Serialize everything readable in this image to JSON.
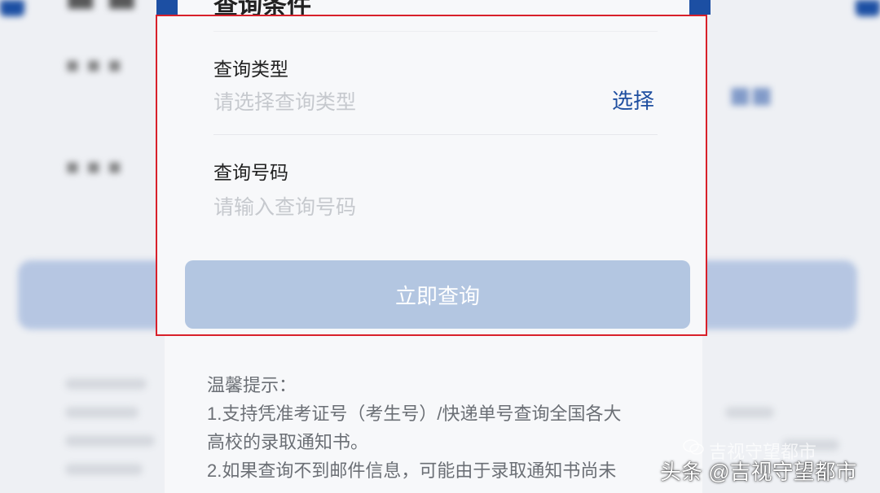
{
  "form": {
    "title": "查询条件",
    "type_label": "查询类型",
    "type_placeholder": "请选择查询类型",
    "select_label": "选择",
    "number_label": "查询号码",
    "number_placeholder": "请输入查询号码",
    "submit_label": "立即查询"
  },
  "tips": {
    "heading": "温馨提示：",
    "line1": "1.支持凭准考证号（考生号）/快递单号查询全国各大",
    "line2": "高校的录取通知书。",
    "line3": "2.如果查询不到邮件信息，可能由于录取通知书尚未"
  },
  "watermark": {
    "faint": "吉视守望都市",
    "main": "头条 @吉视守望都市"
  },
  "colors": {
    "accent": "#1f4fa0",
    "button_disabled": "#b3c6e1",
    "highlight_border": "#d8202a"
  }
}
